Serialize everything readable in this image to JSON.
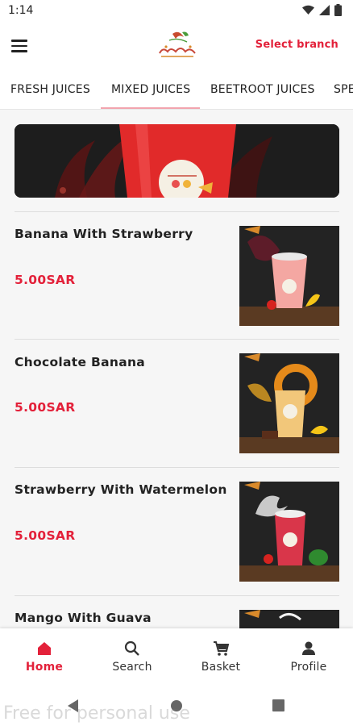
{
  "status_bar": {
    "time": "1:14",
    "icons": [
      "wifi-icon",
      "signal-icon",
      "battery-icon"
    ]
  },
  "app_bar": {
    "menu_icon": "hamburger-menu-icon",
    "logo": "brand-logo",
    "select_branch": "Select branch"
  },
  "tabs": [
    {
      "label": "FRESH JUICES",
      "active": false
    },
    {
      "label": "MIXED JUICES",
      "active": true
    },
    {
      "label": "BEETROOT JUICES",
      "active": false
    },
    {
      "label": "SPE",
      "active": false
    }
  ],
  "products": [
    {
      "name": "Banana With Strawberry",
      "price": "5.00SAR"
    },
    {
      "name": "Chocolate Banana",
      "price": "5.00SAR"
    },
    {
      "name": "Strawberry With Watermelon",
      "price": "5.00SAR"
    },
    {
      "name": "Mango With Guava",
      "price": ""
    }
  ],
  "bottom_nav": [
    {
      "label": "Home",
      "icon": "home-icon",
      "active": true
    },
    {
      "label": "Search",
      "icon": "search-icon",
      "active": false
    },
    {
      "label": "Basket",
      "icon": "cart-icon",
      "active": false
    },
    {
      "label": "Profile",
      "icon": "profile-icon",
      "active": false
    }
  ],
  "watermark": "Free for personal use",
  "colors": {
    "accent": "#e3213a",
    "tab_indicator": "#f2a4ae",
    "background": "#f6f6f6"
  }
}
